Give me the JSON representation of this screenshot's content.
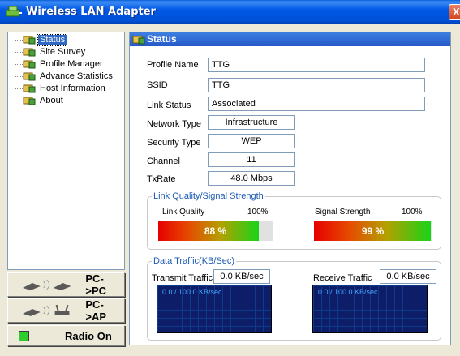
{
  "window": {
    "title": "Wireless LAN Adapter",
    "close_glyph": "X",
    "icon": "network-adapter-icon"
  },
  "nav": {
    "items": [
      {
        "label": "Status",
        "icon": "status-node-icon",
        "selected": true
      },
      {
        "label": "Site Survey",
        "icon": "site-survey-node-icon",
        "selected": false
      },
      {
        "label": "Profile Manager",
        "icon": "profile-node-icon",
        "selected": false
      },
      {
        "label": "Advance Statistics",
        "icon": "stats-node-icon",
        "selected": false
      },
      {
        "label": "Host Information",
        "icon": "host-node-icon",
        "selected": false
      },
      {
        "label": "About",
        "icon": "about-node-icon",
        "selected": false
      }
    ]
  },
  "buttons": {
    "pc_to_pc": "PC->PC",
    "pc_to_ap": "PC->AP",
    "radio": "Radio On",
    "radio_led_color": "#2ecc2e"
  },
  "status": {
    "header": "Status",
    "profile_name_label": "Profile Name",
    "profile_name": "TTG",
    "ssid_label": "SSID",
    "ssid": "TTG",
    "link_status_label": "Link Status",
    "link_status": "Associated",
    "network_type_label": "Network Type",
    "network_type": "Infrastructure",
    "security_type_label": "Security Type",
    "security_type": "WEP",
    "channel_label": "Channel",
    "channel": "11",
    "txrate_label": "TxRate",
    "txrate": "48.0 Mbps"
  },
  "link_quality_group": {
    "title": "Link Quality/Signal Strength",
    "link_quality_label": "Link Quality",
    "link_quality_max": "100%",
    "link_quality_value": "88 %",
    "link_quality_level": 0.88,
    "signal_strength_label": "Signal Strength",
    "signal_strength_max": "100%",
    "signal_strength_value": "99 %",
    "signal_strength_level": 0.99
  },
  "traffic_group": {
    "title": "Data Traffic(KB/Sec)",
    "transmit_label": "Transmit Traffic",
    "transmit_value": "0.0 KB/sec",
    "transmit_graph_text": "0.0 / 100.0 KB/sec",
    "receive_label": "Receive Traffic",
    "receive_value": "0.0 KB/sec",
    "receive_graph_text": "0.0 / 100.0 KB/sec"
  },
  "colors": {
    "title_bar": "#0058e6",
    "header_blue": "#2559c8",
    "group_title": "#1c5ab4",
    "graph_bg": "#0d1d68"
  }
}
